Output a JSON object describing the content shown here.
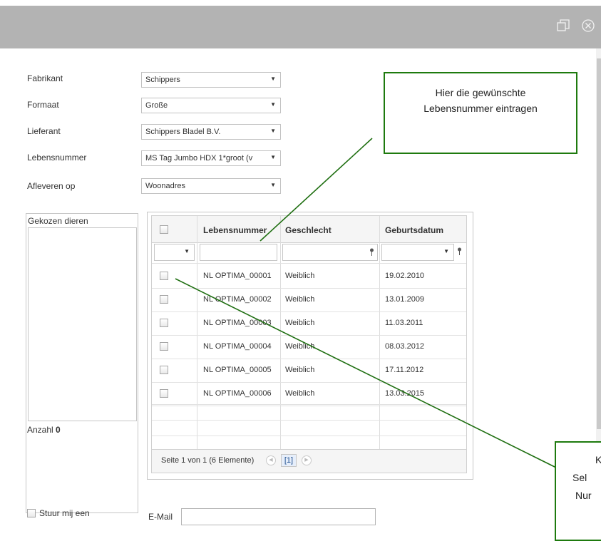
{
  "form": {
    "fabrikant": {
      "label": "Fabrikant",
      "value": "Schippers"
    },
    "formaat": {
      "label": "Formaat",
      "value": "Große"
    },
    "lieferant": {
      "label": "Lieferant",
      "value": "Schippers Bladel B.V."
    },
    "lebensnummer": {
      "label": "Lebensnummer",
      "value": "MS Tag Jumbo HDX 1*groot (v"
    },
    "afleveren": {
      "label": "Afleveren op",
      "value": "Woonadres"
    }
  },
  "gekozen": {
    "title": "Gekozen dieren",
    "count_label": "Anzahl",
    "count": "0"
  },
  "grid": {
    "columns": [
      "Lebensnummer",
      "Geschlecht",
      "Geburtsdatum"
    ],
    "rows": [
      {
        "lebensnummer": "NL OPTIMA_00001",
        "geschlecht": "Weiblich",
        "geburtsdatum": "19.02.2010"
      },
      {
        "lebensnummer": "NL OPTIMA_00002",
        "geschlecht": "Weiblich",
        "geburtsdatum": "13.01.2009"
      },
      {
        "lebensnummer": "NL OPTIMA_00003",
        "geschlecht": "Weiblich",
        "geburtsdatum": "11.03.2011"
      },
      {
        "lebensnummer": "NL OPTIMA_00004",
        "geschlecht": "Weiblich",
        "geburtsdatum": "08.03.2012"
      },
      {
        "lebensnummer": "NL OPTIMA_00005",
        "geschlecht": "Weiblich",
        "geburtsdatum": "17.11.2012"
      },
      {
        "lebensnummer": "NL OPTIMA_00006",
        "geschlecht": "Weiblich",
        "geburtsdatum": "13.03.2015"
      }
    ],
    "pager_text": "Seite 1 von 1 (6 Elemente)",
    "current_page": "[1]"
  },
  "callouts": {
    "top": {
      "line1": "Hier die gewünschte",
      "line2": "Lebensnummer eintragen"
    },
    "bottom": {
      "line1": "K",
      "line2": "Sel",
      "line3": "Nur"
    }
  },
  "footer": {
    "stuur_label": "Stuur mij een",
    "email_label": "E-Mail"
  },
  "icons": {
    "restore": "restore-window-icon",
    "close": "close-circle-icon",
    "filter": "filter-pin-icon"
  },
  "colors": {
    "titlebar": "#b3b3b3",
    "callout_border": "#1e7a0e",
    "annotation_line": "#1e6e10"
  }
}
